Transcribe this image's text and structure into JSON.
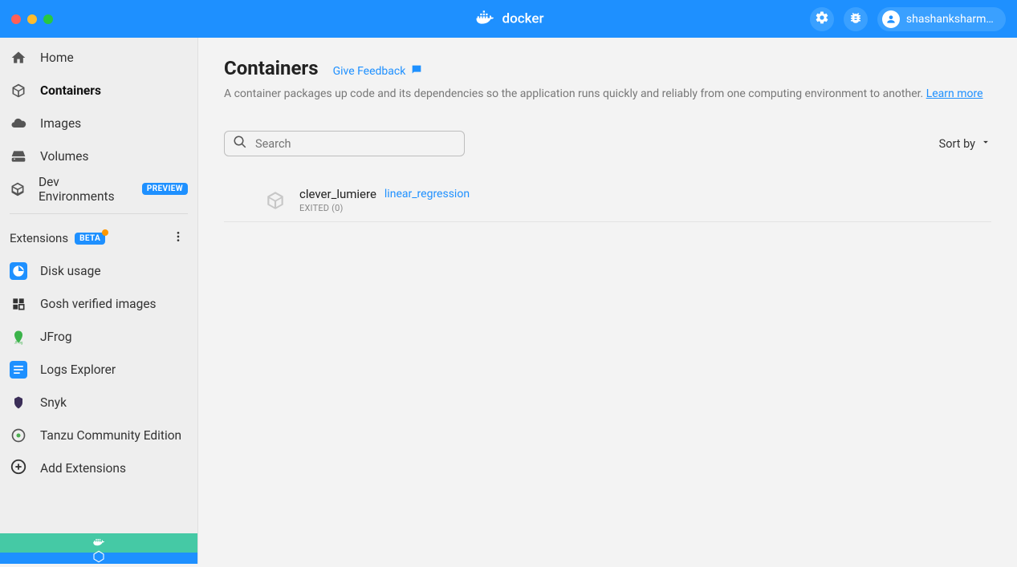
{
  "header": {
    "brand": "docker",
    "user": "shashanksharm..."
  },
  "sidebar": {
    "nav": [
      {
        "label": "Home"
      },
      {
        "label": "Containers"
      },
      {
        "label": "Images"
      },
      {
        "label": "Volumes"
      },
      {
        "label": "Dev Environments",
        "preview": "PREVIEW"
      }
    ],
    "extensions_title": "Extensions",
    "extensions_badge": "BETA",
    "extensions": [
      {
        "label": "Disk usage"
      },
      {
        "label": "Gosh verified images"
      },
      {
        "label": "JFrog"
      },
      {
        "label": "Logs Explorer"
      },
      {
        "label": "Snyk"
      },
      {
        "label": "Tanzu Community Edition"
      }
    ],
    "add_extensions": "Add Extensions"
  },
  "main": {
    "title": "Containers",
    "feedback": "Give Feedback",
    "description": "A container packages up code and its dependencies so the application runs quickly and reliably from one computing environment to another.",
    "learn_more": "Learn more",
    "search_placeholder": "Search",
    "sort_by": "Sort by",
    "containers": [
      {
        "name": "clever_lumiere",
        "image": "linear_regression",
        "status": "EXITED (0)"
      }
    ]
  }
}
